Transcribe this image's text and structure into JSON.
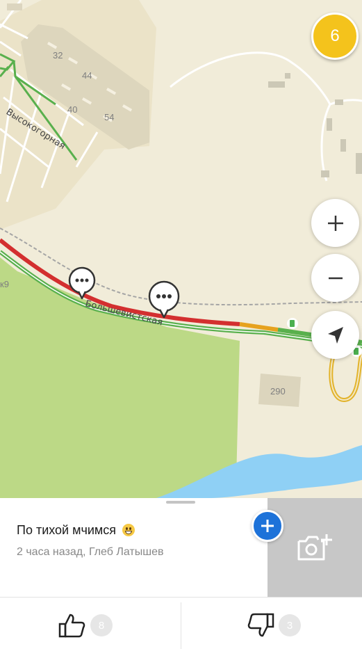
{
  "map": {
    "traffic_level": "6",
    "street_labels": [
      "Высокогорная",
      "Большевистская"
    ],
    "house_numbers": [
      "32",
      "44",
      "40",
      "54",
      "290"
    ],
    "edge_label": "к9",
    "colors": {
      "road_jam": "#d32f2f",
      "road_slow": "#e6a21e",
      "road_free": "#59b04d",
      "park": "#bcd986",
      "river": "#8fd0f5",
      "background": "#f1ecd9",
      "traffic_badge": "#f4c31c"
    },
    "icons": {
      "zoom_in": "plus-icon",
      "zoom_out": "minus-icon",
      "locate": "navigation-arrow-icon",
      "comment_markers": "speech-bubble-icon",
      "fuel": "fuel-station-icon"
    }
  },
  "comment": {
    "text": "По тихой мчимся",
    "meta": "2 часа назад, Глеб Латышев",
    "likes": "8",
    "dislikes": "3",
    "icons": {
      "add": "plus-icon",
      "photo": "add-photo-icon",
      "like": "thumbs-up-icon",
      "dislike": "thumbs-down-icon"
    }
  }
}
